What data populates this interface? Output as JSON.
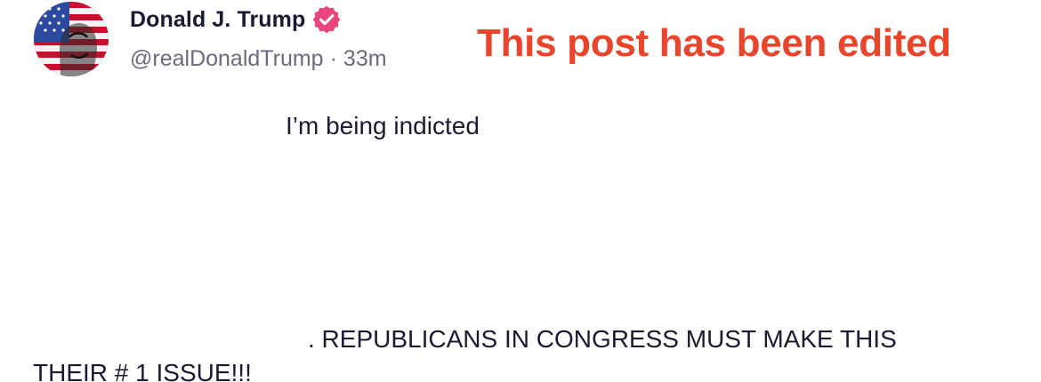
{
  "post": {
    "author": {
      "display_name": "Donald J. Trump",
      "handle": "@realDonaldTrump",
      "separator": "·",
      "time_ago": "33m",
      "verified": true,
      "verified_badge_color": "#e8457a"
    },
    "edited_banner": "This post has been edited",
    "edited_banner_color": "#e8452c",
    "body_lines": [
      "I’m being indicted",
      ". REPUBLICANS IN CONGRESS MUST MAKE THIS",
      "THEIR # 1 ISSUE!!!"
    ]
  },
  "icons": {
    "avatar": "profile-avatar-flag",
    "verified": "verified-badge-icon"
  }
}
